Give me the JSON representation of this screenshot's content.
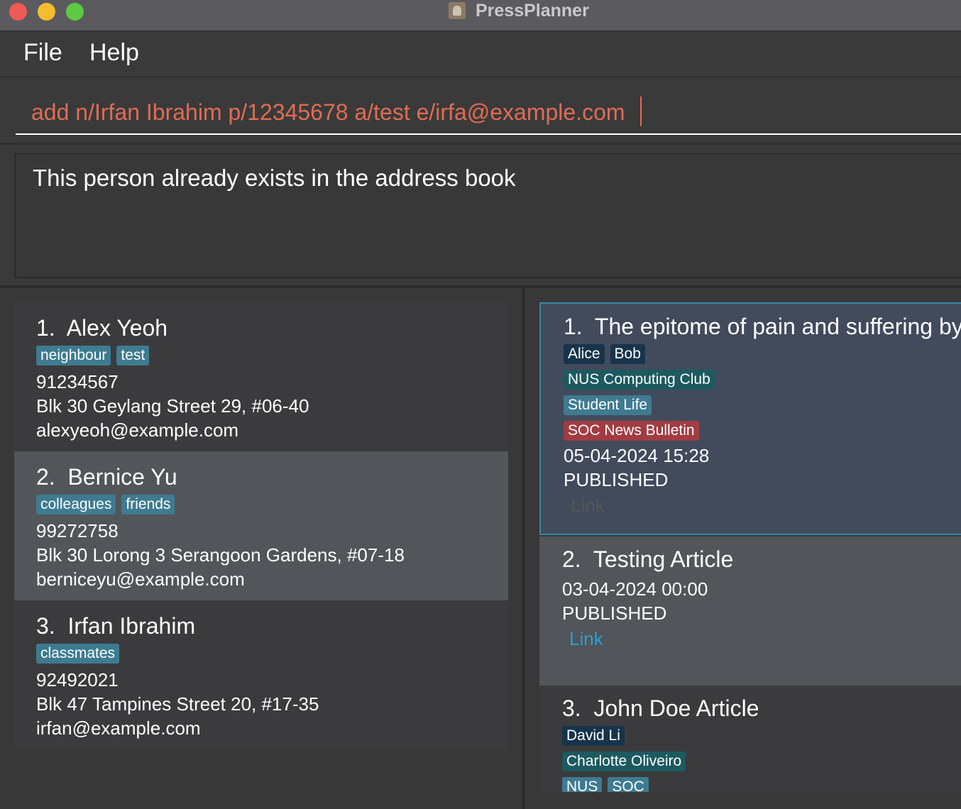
{
  "window": {
    "title": "PressPlanner"
  },
  "menu": {
    "file": "File",
    "help": "Help"
  },
  "command": {
    "value": "add n/Irfan Ibrahim p/12345678 a/test e/irfa@example.com"
  },
  "result": {
    "text": "This person already exists in the address book"
  },
  "persons": [
    {
      "index": "1.",
      "name": "Alex Yeoh",
      "tags": [
        "neighbour",
        "test"
      ],
      "phone": "91234567",
      "address": "Blk 30 Geylang Street 29, #06-40",
      "email": "alexyeoh@example.com"
    },
    {
      "index": "2.",
      "name": "Bernice Yu",
      "tags": [
        "colleagues",
        "friends"
      ],
      "phone": "99272758",
      "address": "Blk 30 Lorong 3 Serangoon Gardens, #07-18",
      "email": "berniceyu@example.com"
    },
    {
      "index": "3.",
      "name": "Irfan Ibrahim",
      "tags": [
        "classmates"
      ],
      "phone": "92492021",
      "address": "Blk 47 Tampines Street 20, #17-35",
      "email": "irfan@example.com"
    }
  ],
  "articles": [
    {
      "index": "1.",
      "title": "The epitome of pain and suffering by NUS",
      "authors": [
        "Alice",
        "Bob"
      ],
      "sources": [
        "NUS Computing Club"
      ],
      "categories": [
        "Student Life"
      ],
      "outlets": [
        "SOC News Bulletin"
      ],
      "date": "05-04-2024 15:28",
      "status": "PUBLISHED",
      "link": "Link"
    },
    {
      "index": "2.",
      "title": "Testing Article",
      "date": "03-04-2024 00:00",
      "status": "PUBLISHED",
      "link": "Link"
    },
    {
      "index": "3.",
      "title": "John Doe Article",
      "authors": [
        "David Li"
      ],
      "sources": [
        "Charlotte Oliveiro"
      ],
      "categories": [
        "NUS",
        "SOC"
      ]
    }
  ],
  "colors": {
    "command_text": "#e06c55",
    "tag_teal": "#3e7b91",
    "tag_dark": "#17344a",
    "tag_green": "#1c5a5f",
    "tag_red": "#a13c43",
    "link_active": "#2a9fd6",
    "link_inactive": "#555555",
    "selected_card": "#424b5c",
    "card_even": "#525559",
    "card_odd": "#3b3b3d"
  }
}
